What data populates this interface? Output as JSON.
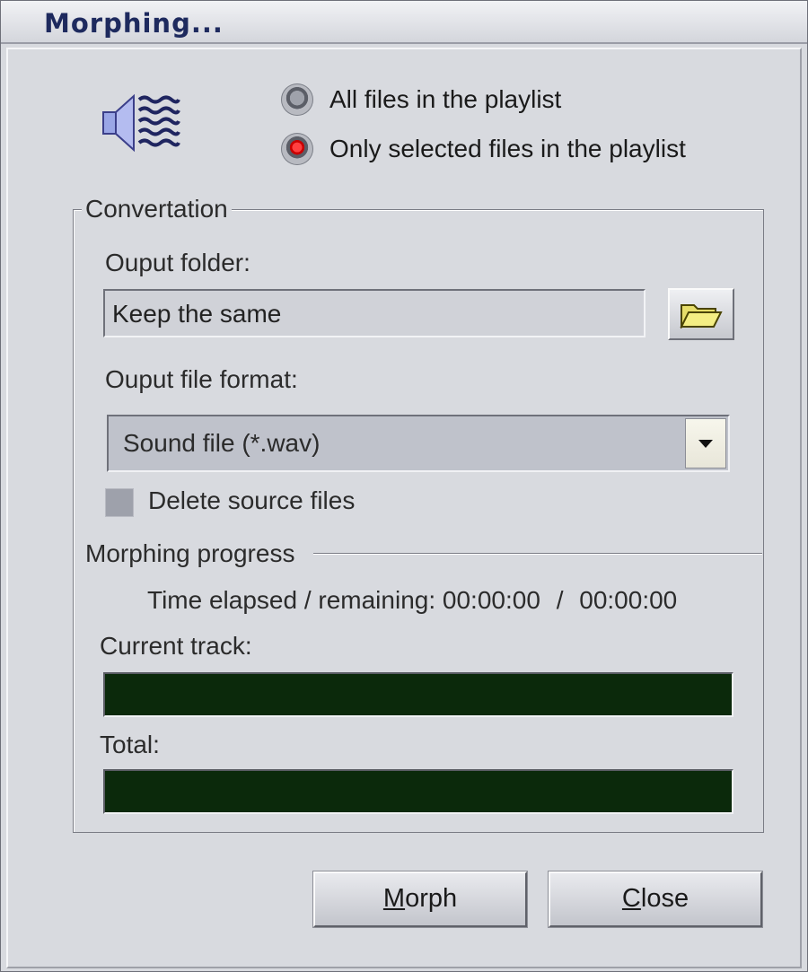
{
  "window": {
    "title": "Morphing..."
  },
  "scope": {
    "options": [
      {
        "label": "All files in the playlist",
        "selected": false
      },
      {
        "label": "Only selected files in the playlist",
        "selected": true
      }
    ]
  },
  "conversion": {
    "legend": "Convertation",
    "output_folder_label": "Ouput folder:",
    "output_folder_value": "Keep the same",
    "output_format_label": "Ouput file format:",
    "output_format_value": "Sound file (*.wav)",
    "delete_source_label": "Delete source files",
    "delete_source_checked": false
  },
  "progress": {
    "legend": "Morphing progress",
    "time_label": "Time elapsed / remaining:",
    "time_elapsed": "00:00:00",
    "time_separator": "/",
    "time_remaining": "00:00:00",
    "current_track_label": "Current track:",
    "current_track_fraction": 0,
    "total_label": "Total:",
    "total_fraction": 0
  },
  "buttons": {
    "morph_first": "M",
    "morph_rest": "orph",
    "close_first": "C",
    "close_rest": "lose"
  },
  "colors": {
    "title_text": "#1e2a5e",
    "progress_bg": "#0b290b",
    "radio_selected": "#c90000"
  },
  "icons": [
    "speaker-wave-icon",
    "folder-open-icon",
    "dropdown-arrow-icon"
  ]
}
